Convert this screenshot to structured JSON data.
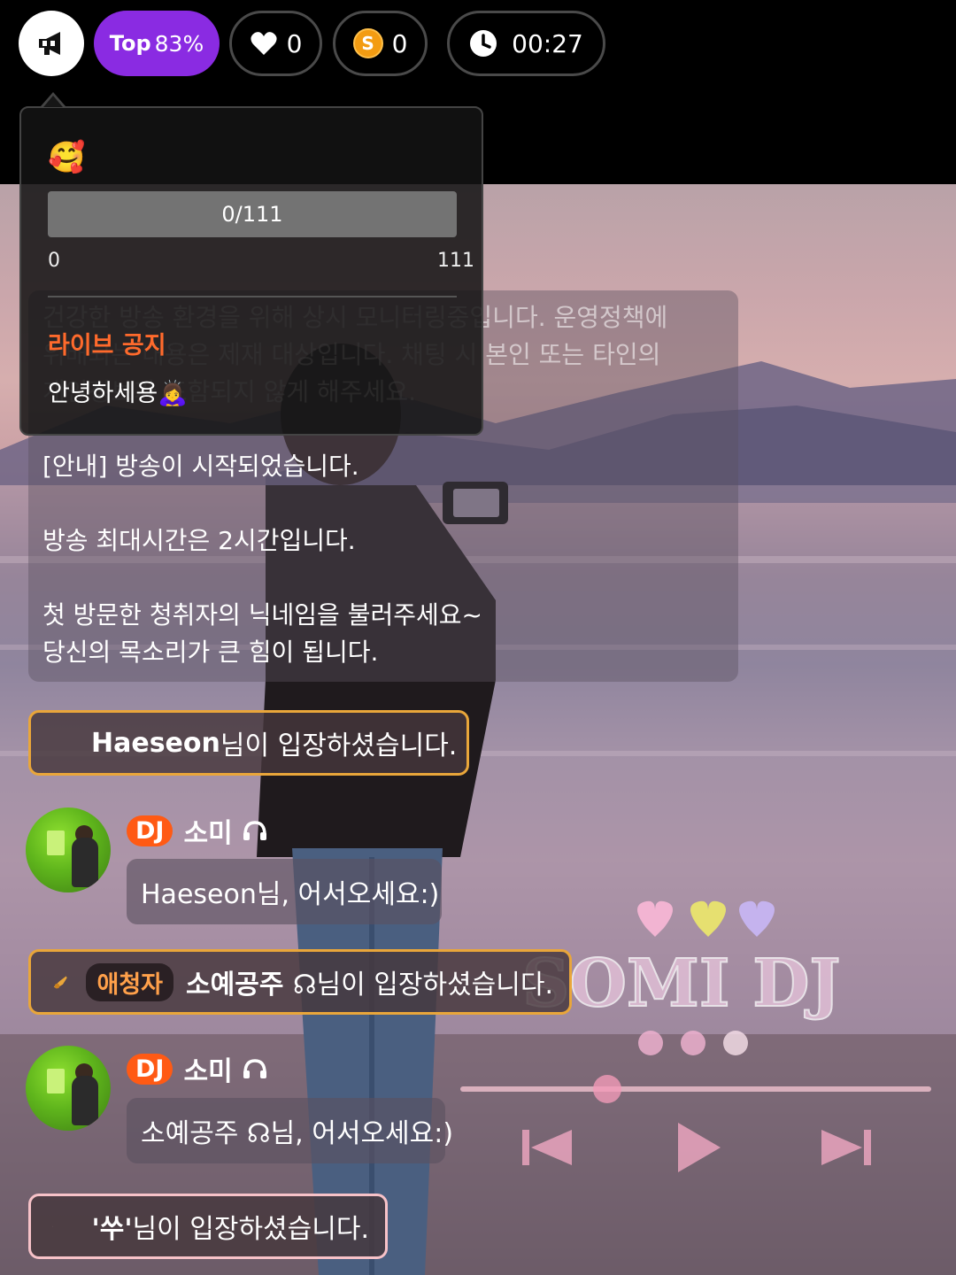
{
  "topbar": {
    "top_label": "Top",
    "top_percent": "83%",
    "likes": "0",
    "coin_symbol": "S",
    "coins": "0",
    "timer": "00:27"
  },
  "notice": {
    "emoji": "🥰",
    "progress_text": "0/111",
    "progress_fraction": 0,
    "range_min": "0",
    "range_max": "111",
    "label": "라이브 공지",
    "body": "안녕하세용🙇‍♀️"
  },
  "system": {
    "policy_lines": [
      "건강한 방송 환경을 위해 상시 모니터링중입니다. 운영정책에",
      "위배되는 내용은 제재 대상입니다. 채팅 시 본인 또는 타인의",
      "개인정보가 포함되지 않게 해주세요."
    ],
    "notice_start": "[안내] 방송이 시작되었습니다.",
    "notice_maxtime": "방송 최대시간은 2시간입니다.",
    "notice_call1": "첫 방문한 청취자의 닉네임을 불러주세요~",
    "notice_call2": "당신의 목소리가 큰 힘이 됩니다."
  },
  "entries": [
    {
      "name": "Haeseon",
      "suffix": "님이 입장하셨습니다."
    },
    {
      "badge": "애청자",
      "name": "소예공주 ☊",
      "suffix": "님이 입장하셨습니다."
    },
    {
      "name": "'쑤'",
      "suffix": "님이 입장하셨습니다."
    }
  ],
  "chats": [
    {
      "badge": "DJ",
      "name": "소미",
      "message": "Haeseon님, 어서오세요:)"
    },
    {
      "badge": "DJ",
      "name": "소미",
      "message": "소예공주 ☊님, 어서오세요:)"
    }
  ],
  "scene": {
    "title": "SOMI DJ"
  },
  "colors": {
    "top_pill": "#8a2be2",
    "accent_orange": "#ff5a14",
    "entry_border": "#e9a63a",
    "notice_label": "#ff6a2c"
  }
}
